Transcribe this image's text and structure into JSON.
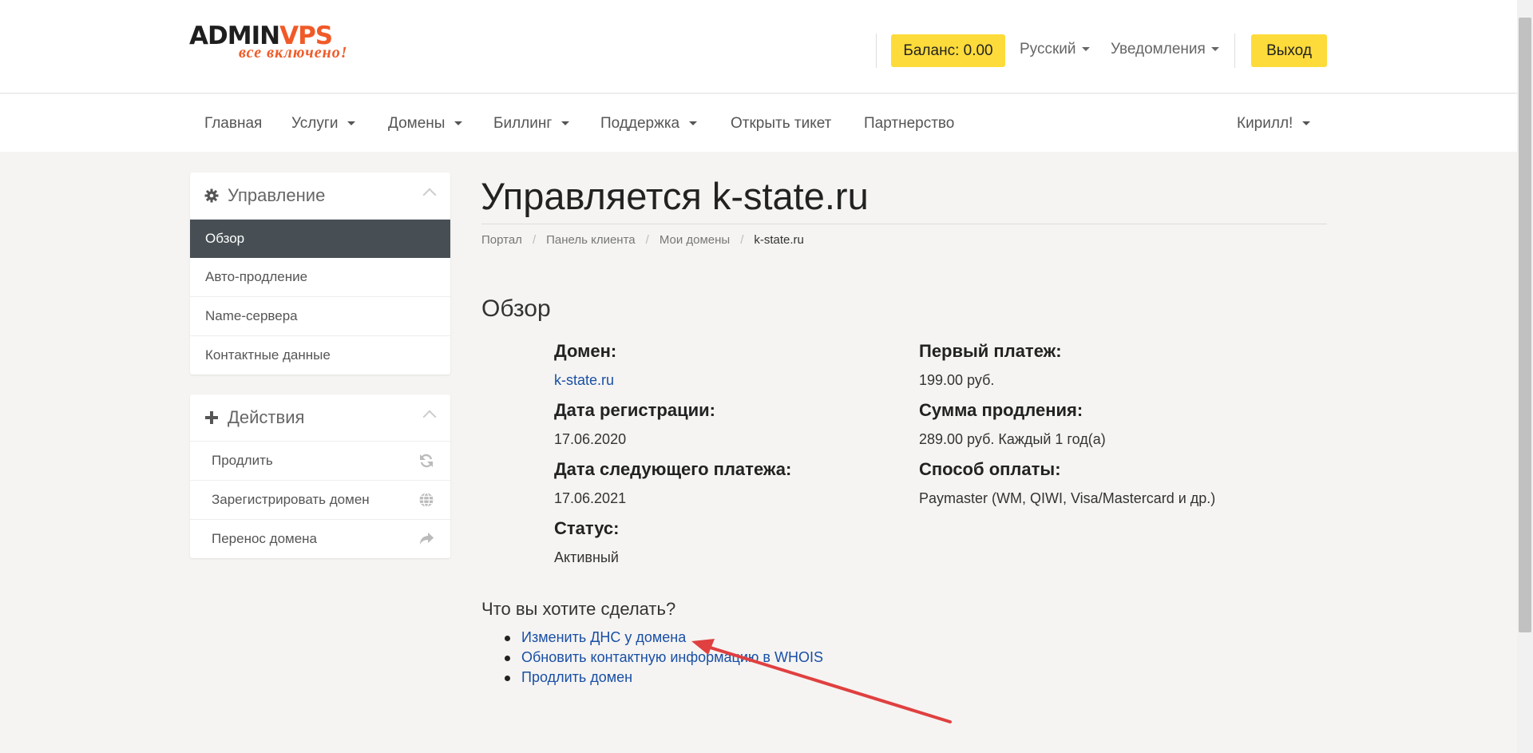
{
  "header": {
    "logo": {
      "admin": "ADMIN",
      "v": "V",
      "ps": "PS",
      "tagline": "все включено!"
    },
    "balance_label": "Баланс: 0.00",
    "language_label": "Русский",
    "notifications_label": "Уведомления",
    "logout_label": "Выход",
    "accent_color": "#fddb3a",
    "brand_color": "#f05a28"
  },
  "nav": {
    "items": [
      "Главная",
      "Услуги",
      "Домены",
      "Биллинг",
      "Поддержка",
      "Открыть тикет",
      "Партнерство"
    ],
    "user_label": "Кирилл!"
  },
  "sidebar": {
    "manage": {
      "title": "Управление",
      "icon": "gear-icon",
      "items": [
        "Обзор",
        "Авто-продление",
        "Name-сервера",
        "Контактные данные"
      ]
    },
    "actions": {
      "title": "Действия",
      "icon": "plus-icon",
      "items": [
        {
          "label": "Продлить",
          "icon": "refresh-icon"
        },
        {
          "label": "Зарегистрировать домен",
          "icon": "globe-icon"
        },
        {
          "label": "Перенос домена",
          "icon": "share-arrow-icon"
        }
      ]
    }
  },
  "main": {
    "title": "Управляется k-state.ru",
    "breadcrumbs": [
      "Портал",
      "Панель клиента",
      "Мои домены",
      "k-state.ru"
    ],
    "section_title": "Обзор",
    "details_left": [
      {
        "label": "Домен:",
        "value": "k-state.ru"
      },
      {
        "label": "Дата регистрации:",
        "value": "17.06.2020"
      },
      {
        "label": "Дата следующего платежа:",
        "value": "17.06.2021"
      },
      {
        "label": "Статус:",
        "value": "Активный"
      }
    ],
    "details_right": [
      {
        "label": "Первый платеж:",
        "value": "199.00 руб."
      },
      {
        "label": "Сумма продления:",
        "value": "289.00 руб. Каждый 1 год(а)"
      },
      {
        "label": "Способ оплаты:",
        "value": "Paymaster (WM, QIWI, Visa/Mastercard и др.)"
      }
    ],
    "question": "Что вы хотите сделать?",
    "actions": [
      "Изменить ДНС у домена",
      "Обновить контактную информацию в WHOIS",
      "Продлить домен"
    ]
  },
  "annotation": {
    "arrow_color": "#e04040"
  }
}
